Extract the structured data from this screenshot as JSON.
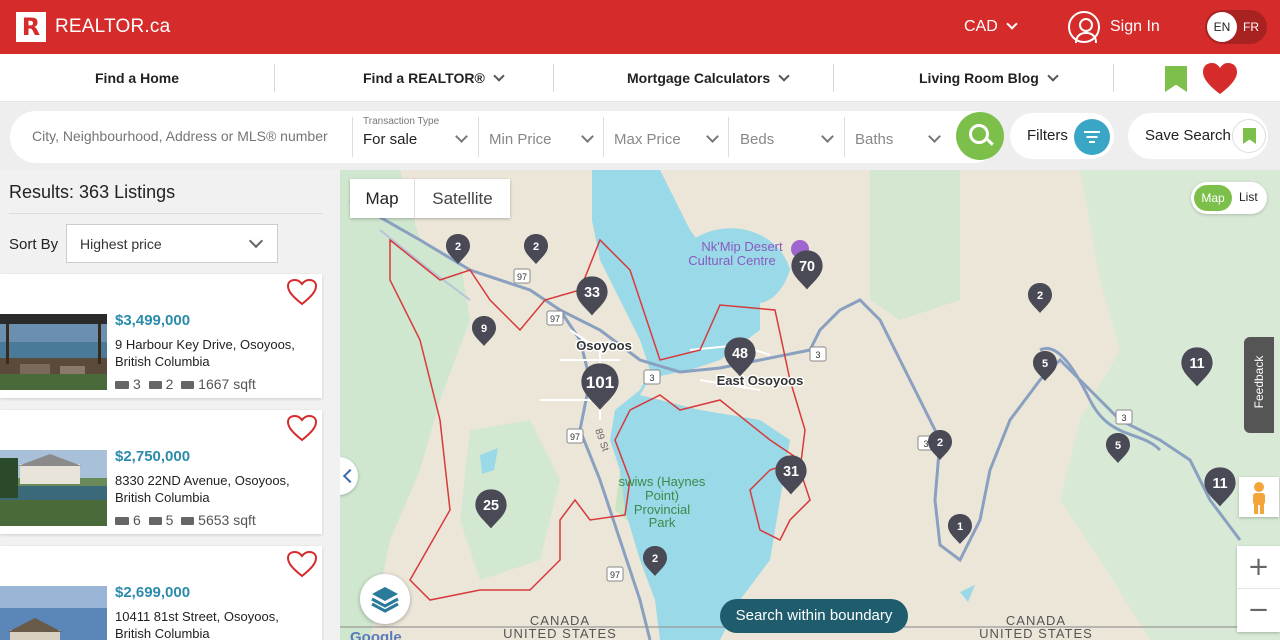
{
  "header": {
    "logo_letter": "R",
    "logo_text": "REALTOR.ca",
    "currency": "CAD",
    "sign_in": "Sign In",
    "lang_active": "EN",
    "lang_other": "FR",
    "brand_color": "#d52b2b"
  },
  "nav": {
    "items": [
      {
        "label": "Find a Home"
      },
      {
        "label": "Find a REALTOR®"
      },
      {
        "label": "Mortgage Calculators"
      },
      {
        "label": "Living Room Blog"
      }
    ]
  },
  "search": {
    "placeholder": "City, Neighbourhood, Address or MLS® number",
    "transaction_label": "Transaction Type",
    "transaction_value": "For sale",
    "min_price": "Min Price",
    "max_price": "Max Price",
    "beds": "Beds",
    "baths": "Baths",
    "filters": "Filters",
    "save_search": "Save Search",
    "accent_color": "#7cc04b"
  },
  "sidebar": {
    "results_label": "Results:",
    "results_count": "363 Listings",
    "sort_by": "Sort By",
    "sort_value": "Highest price",
    "listings": [
      {
        "price": "$3,499,000",
        "address": "9 Harbour Key Drive, Osoyoos, British Columbia",
        "beds": "3",
        "baths": "2",
        "sqft": "1667 sqft"
      },
      {
        "price": "$2,750,000",
        "address": "8330 22ND Avenue, Osoyoos, British Columbia",
        "beds": "6",
        "baths": "5",
        "sqft": "5653 sqft"
      },
      {
        "price": "$2,699,000",
        "address": "10411 81st Street, Osoyoos, British Columbia",
        "beds": "",
        "baths": "",
        "sqft": ""
      }
    ]
  },
  "map": {
    "mode_map": "Map",
    "mode_satellite": "Satellite",
    "view_map": "Map",
    "view_list": "List",
    "feedback": "Feedback",
    "search_boundary": "Search within boundary",
    "zoom_in": "+",
    "zoom_out": "−",
    "places": {
      "osoyoos": "Osoyoos",
      "east_osoyoos": "East Osoyoos",
      "nkmip_1": "Nk'Mip Desert",
      "nkmip_2": "Cultural Centre",
      "park_1": "swiws (Haynes",
      "park_2": "Point)",
      "park_3": "Provincial",
      "park_4": "Park",
      "st89": "89 St",
      "canada_1": "CANADA",
      "us_1": "UNITED STATES",
      "canada_2": "CANADA",
      "us_2": "UNITED STATES",
      "google": "Google"
    },
    "route_shields": [
      "97",
      "97",
      "3",
      "97",
      "3",
      "3",
      "3",
      "97"
    ],
    "pins": [
      "2",
      "2",
      "70",
      "33",
      "9",
      "48",
      "101",
      "2",
      "5",
      "11",
      "2",
      "5",
      "31",
      "11",
      "25",
      "1",
      "2"
    ]
  }
}
